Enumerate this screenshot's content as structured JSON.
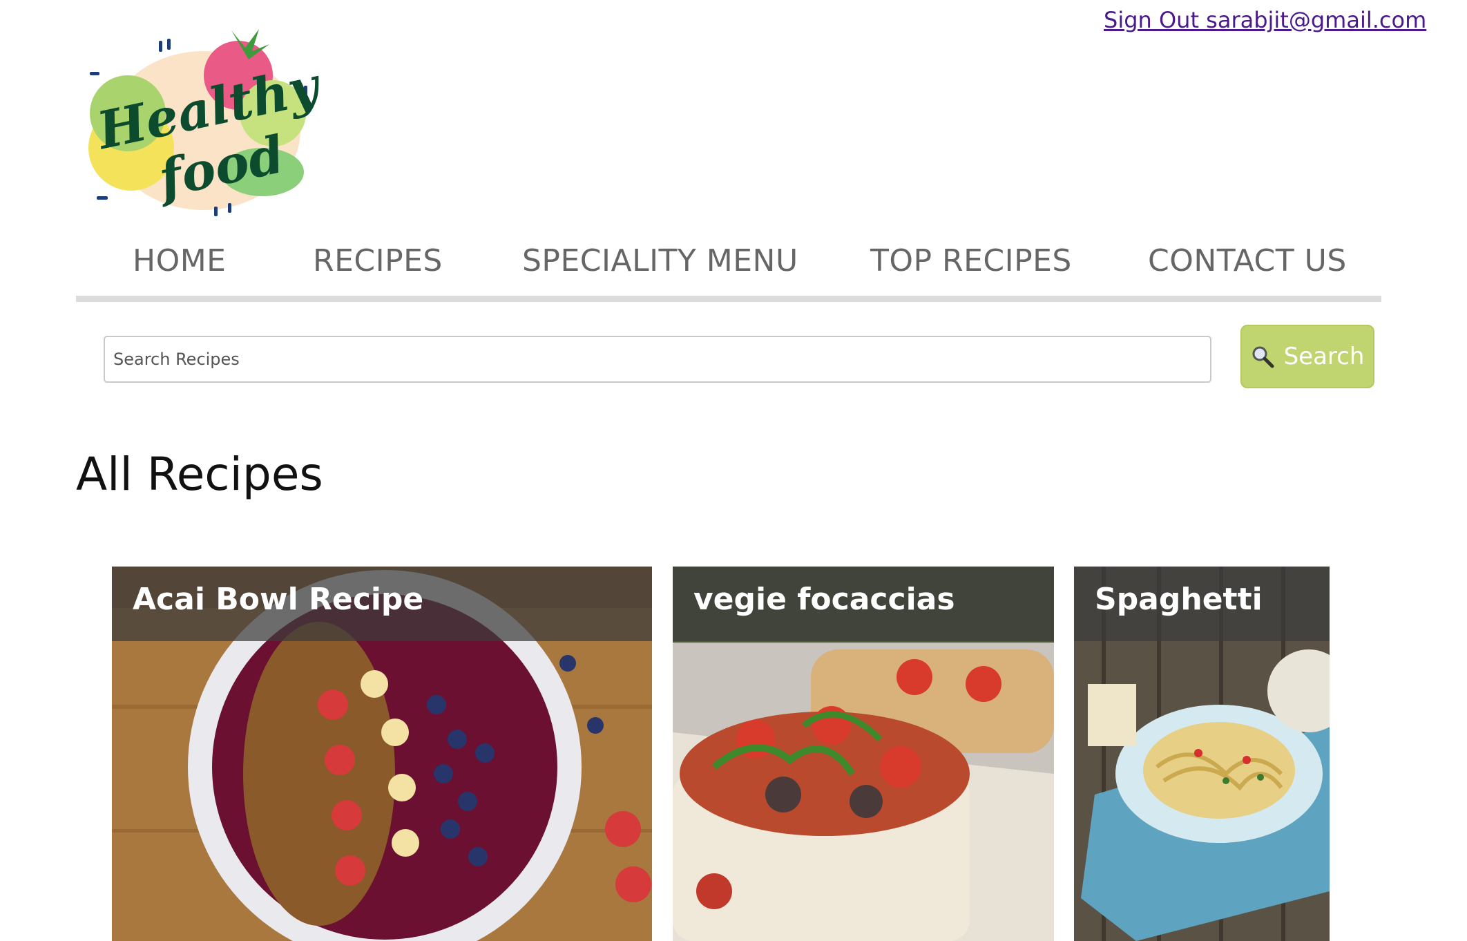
{
  "header": {
    "account_link": "Sign Out sarabjit@gmail.com",
    "logo": {
      "line1": "Healthy",
      "line2": "food"
    }
  },
  "nav": {
    "items": [
      {
        "label": "HOME"
      },
      {
        "label": "RECIPES"
      },
      {
        "label": "SPECIALITY MENU"
      },
      {
        "label": "TOP RECIPES"
      },
      {
        "label": "CONTACT US"
      }
    ]
  },
  "search": {
    "placeholder": "Search Recipes",
    "button_label": "Search",
    "icon": "magnifier-icon"
  },
  "main": {
    "title": "All Recipes",
    "recipes": [
      {
        "title": "Acai Bowl Recipe",
        "image": "acai-bowl-photo"
      },
      {
        "title": "vegie focaccias",
        "image": "focaccia-photo"
      },
      {
        "title": "Spaghetti",
        "image": "spaghetti-photo"
      }
    ]
  },
  "colors": {
    "accent": "#c0d56f",
    "link": "#4a1a8c",
    "nav_text": "#666666",
    "divider": "#dcdcdc"
  }
}
